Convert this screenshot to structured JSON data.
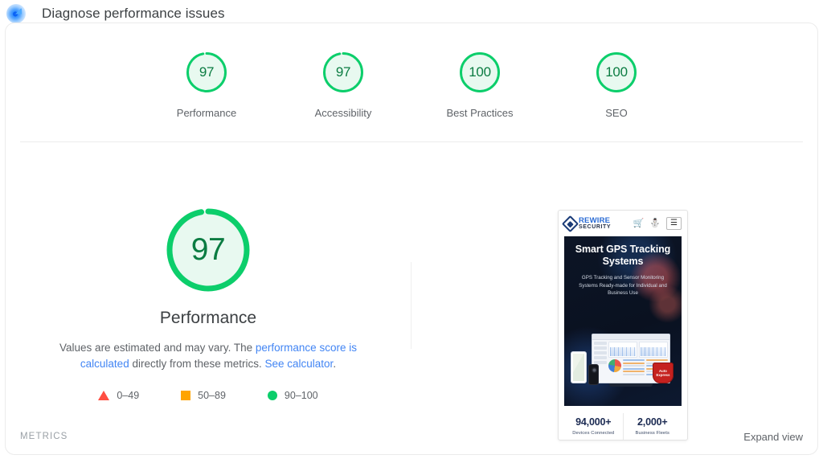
{
  "header": {
    "icon": "lighthouse-icon",
    "title": "Diagnose performance issues"
  },
  "colors": {
    "pass": "#0cce6b",
    "pass_text": "#0b7c42",
    "pass_fill": "#e8f9f0",
    "average": "#ffa400",
    "fail": "#ff4e42",
    "link": "#4285f4"
  },
  "category_scores": [
    {
      "score": "97",
      "label": "Performance",
      "percent": 97,
      "state": "pass"
    },
    {
      "score": "97",
      "label": "Accessibility",
      "percent": 97,
      "state": "pass"
    },
    {
      "score": "100",
      "label": "Best Practices",
      "percent": 100,
      "state": "pass"
    },
    {
      "score": "100",
      "label": "SEO",
      "percent": 100,
      "state": "pass"
    }
  ],
  "detail": {
    "score": "97",
    "percent": 97,
    "label": "Performance",
    "description_part1": "Values are estimated and may vary. The ",
    "link1": "performance score is calculated",
    "description_part2": " directly from these metrics. ",
    "link2": "See calculator",
    "description_part3": "."
  },
  "legend": [
    {
      "shape": "triangle-icon",
      "range": "0–49"
    },
    {
      "shape": "square-icon",
      "range": "50–89"
    },
    {
      "shape": "circle-icon",
      "range": "90–100"
    }
  ],
  "preview": {
    "brand_line1": "REWIRE",
    "brand_line2": "SECURITY",
    "nav_icons": [
      "cart-icon",
      "account-icon",
      "hamburger-menu-icon"
    ],
    "cart_glyph": "Ὥ2",
    "hero_heading": "Smart GPS Tracking Systems",
    "hero_subtext": "GPS Tracking and Sensor Monitoring Systems Ready-made for Individual and Business Use",
    "award_badge": "Auto Express",
    "stats": [
      {
        "number": "94,000+",
        "caption": "Devices Connected"
      },
      {
        "number": "2,000+",
        "caption": "Business Fleets"
      }
    ]
  },
  "footer": {
    "metrics_label": "METRICS",
    "expand_view": "Expand view"
  }
}
